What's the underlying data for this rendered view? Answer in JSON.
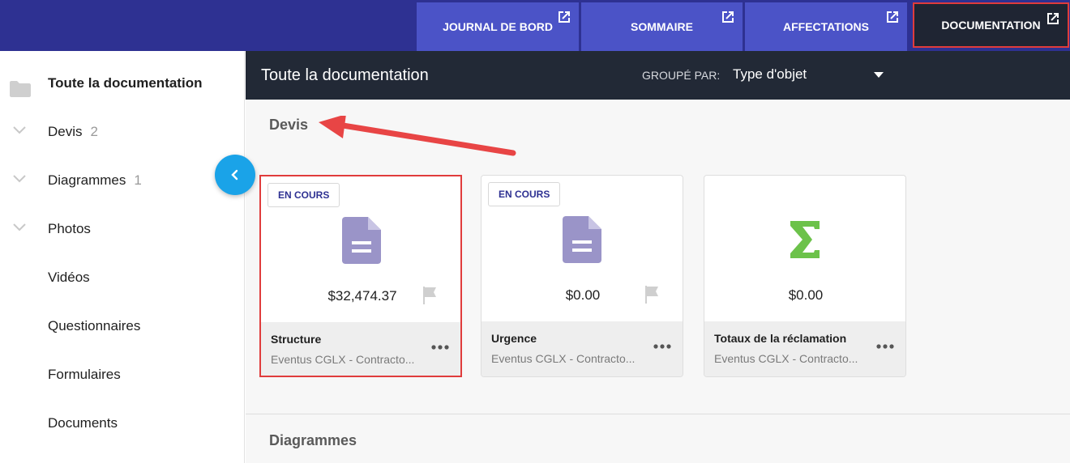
{
  "tabs": [
    {
      "label": "JOURNAL DE BORD"
    },
    {
      "label": "SOMMAIRE"
    },
    {
      "label": "AFFECTATIONS"
    },
    {
      "label": "DOCUMENTATION",
      "active": true
    }
  ],
  "sidebar": {
    "items": [
      {
        "label": "Toute la documentation",
        "icon": "folder-icon",
        "bold": true
      },
      {
        "label": "Devis",
        "count": "2",
        "icon": "chevron-down-icon"
      },
      {
        "label": "Diagrammes",
        "count": "1",
        "icon": "chevron-down-icon"
      },
      {
        "label": "Photos",
        "icon": "chevron-down-icon"
      },
      {
        "label": "Vidéos"
      },
      {
        "label": "Questionnaires"
      },
      {
        "label": "Formulaires"
      },
      {
        "label": "Documents"
      }
    ]
  },
  "main": {
    "title": "Toute la documentation",
    "group_label": "GROUPÉ PAR:",
    "group_value": "Type d'objet",
    "sections": [
      {
        "title": "Devis"
      },
      {
        "title": "Diagrammes"
      }
    ],
    "cards": [
      {
        "badge": "EN COURS",
        "icon": "document-icon",
        "amount": "$32,474.37",
        "flag": true,
        "name": "Structure",
        "sub": "Eventus CGLX - Contracto..."
      },
      {
        "badge": "EN COURS",
        "icon": "document-icon",
        "amount": "$0.00",
        "flag": true,
        "name": "Urgence",
        "sub": "Eventus CGLX - Contracto..."
      },
      {
        "badge": "",
        "icon": "sigma-icon",
        "amount": "$0.00",
        "flag": false,
        "name": "Totaux de la réclamation",
        "sub": "Eventus CGLX - Contracto..."
      }
    ]
  },
  "colors": {
    "topbar": "#2e3192",
    "tab": "#4b53c7",
    "active_tab": "#1f2533",
    "highlight": "#e03c3c",
    "accent": "#1aa3e8",
    "doc_icon": "#9a94c8",
    "sigma": "#6cc24a"
  }
}
